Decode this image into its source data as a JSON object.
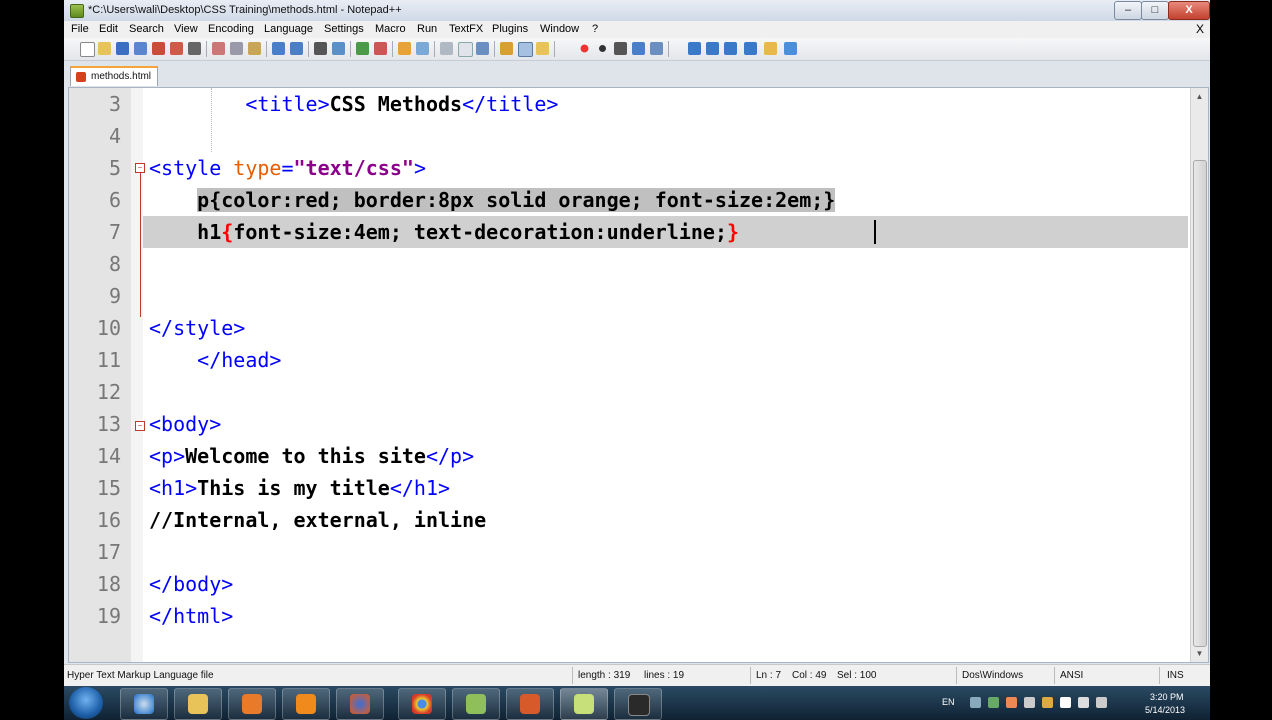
{
  "window": {
    "title": "*C:\\Users\\wali\\Desktop\\CSS Training\\methods.html - Notepad++",
    "min": "–",
    "max": "□",
    "close": "X"
  },
  "menu": {
    "items": [
      "File",
      "Edit",
      "Search",
      "View",
      "Encoding",
      "Language",
      "Settings",
      "Macro",
      "Run",
      "TextFX",
      "Plugins",
      "Window",
      "?"
    ],
    "close_x": "X"
  },
  "tab": {
    "label": "methods.html"
  },
  "editor": {
    "lines": [
      {
        "n": "3"
      },
      {
        "n": "4"
      },
      {
        "n": "5"
      },
      {
        "n": "6"
      },
      {
        "n": "7"
      },
      {
        "n": "8"
      },
      {
        "n": "9"
      },
      {
        "n": "10"
      },
      {
        "n": "11"
      },
      {
        "n": "12"
      },
      {
        "n": "13"
      },
      {
        "n": "14"
      },
      {
        "n": "15"
      },
      {
        "n": "16"
      },
      {
        "n": "17"
      },
      {
        "n": "18"
      },
      {
        "n": "19"
      }
    ],
    "code": {
      "l3": {
        "open": "<title>",
        "text": "CSS Methods",
        "close": "</title>"
      },
      "l5": {
        "open": "<style ",
        "attr": "type",
        "eq": "=",
        "str": "\"text/css\"",
        "end": ">"
      },
      "l6": {
        "text": "p{color:red; border:8px solid orange; font-size:2em;}"
      },
      "l7": {
        "pre": "h1",
        "ob": "{",
        "text": "font-size:4em; text-decoration:underline;",
        "cb": "}"
      },
      "l10": {
        "tag": "</style>"
      },
      "l11": {
        "tag": "</head>"
      },
      "l13": {
        "tag": "<body>"
      },
      "l14": {
        "open": "<p>",
        "text": "Welcome to this site",
        "close": "</p>"
      },
      "l15": {
        "open": "<h1>",
        "text": "This is my title",
        "close": "</h1>"
      },
      "l16": {
        "text": "//Internal, external, inline"
      },
      "l18": {
        "tag": "</body>"
      },
      "l19": {
        "tag": "</html>"
      }
    }
  },
  "status": {
    "filetype": "Hyper Text Markup Language file",
    "length": "length : 319",
    "lines": "lines : 19",
    "ln": "Ln : 7",
    "col": "Col : 49",
    "sel": "Sel : 100",
    "eol": "Dos\\Windows",
    "enc": "ANSI",
    "ins": "INS"
  },
  "taskbar": {
    "lang": "EN",
    "time": "3:20 PM",
    "date": "5/14/2013"
  },
  "colors": {
    "tag": "#0000ff",
    "attr": "#e85d00",
    "string": "#8a008a",
    "brace": "#ff0000",
    "selection": "#c0c0c0"
  }
}
